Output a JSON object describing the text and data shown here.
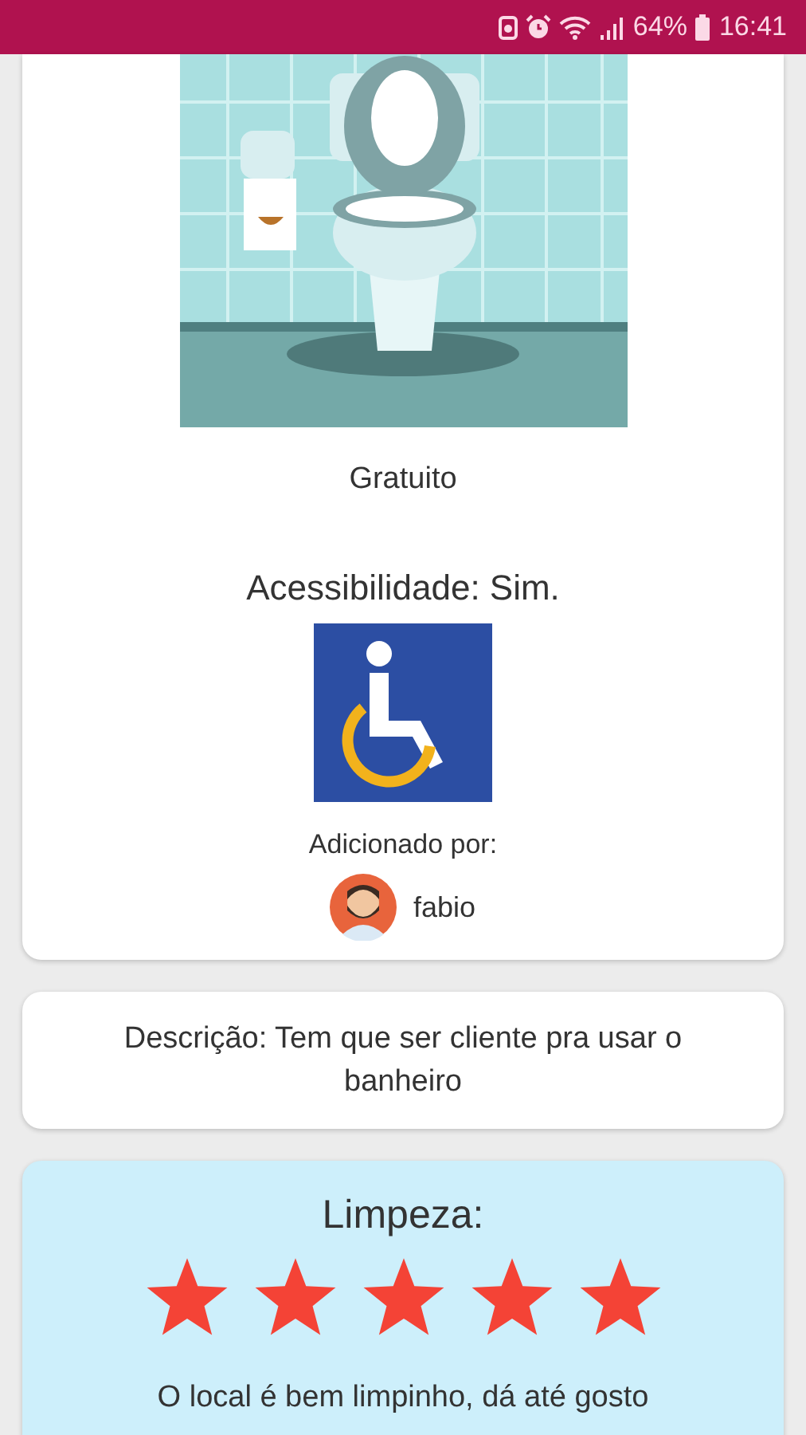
{
  "status_bar": {
    "battery": "64%",
    "time": "16:41"
  },
  "place": {
    "price": "Gratuito",
    "accessibility": "Acessibilidade: Sim.",
    "added_by_label": "Adicionado por:",
    "user": "fabio"
  },
  "description": "Descrição: Tem que ser cliente pra usar o banheiro",
  "review": {
    "title": "Limpeza:",
    "stars": 5,
    "comment": "O local é bem limpinho, dá até gosto"
  }
}
